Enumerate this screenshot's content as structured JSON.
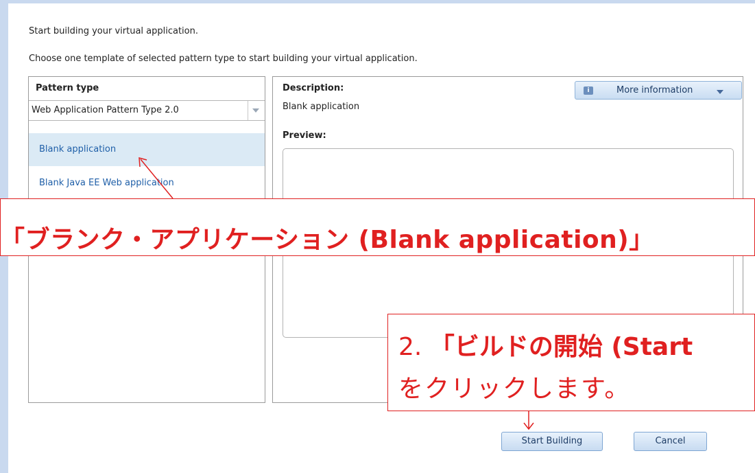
{
  "intro": {
    "line1": "Start building your virtual application.",
    "line2": "Choose one template of selected pattern type to start building your virtual application."
  },
  "left_panel": {
    "header": "Pattern type",
    "pattern_select": {
      "value": "Web Application Pattern Type 2.0"
    },
    "templates": [
      {
        "label": "Blank application",
        "selected": true
      },
      {
        "label": "Blank Java EE Web application",
        "selected": false
      }
    ]
  },
  "right_panel": {
    "description_label": "Description:",
    "description_value": "Blank application",
    "preview_label": "Preview:",
    "more_info_label": "More information",
    "info_icon": "i"
  },
  "buttons": {
    "start_building": "Start Building",
    "cancel": "Cancel"
  },
  "annotations": {
    "callout1": "「ブランク・アプリケーション (Blank application)」",
    "callout2_number": "2.",
    "callout2_bold": "「ビルドの開始 (Start",
    "callout2_line2": "をクリックします。",
    "color": "#e02020"
  },
  "icons": {
    "dropdown": "chevron-down-icon",
    "info": "info-icon",
    "more_caret": "caret-down-icon"
  }
}
